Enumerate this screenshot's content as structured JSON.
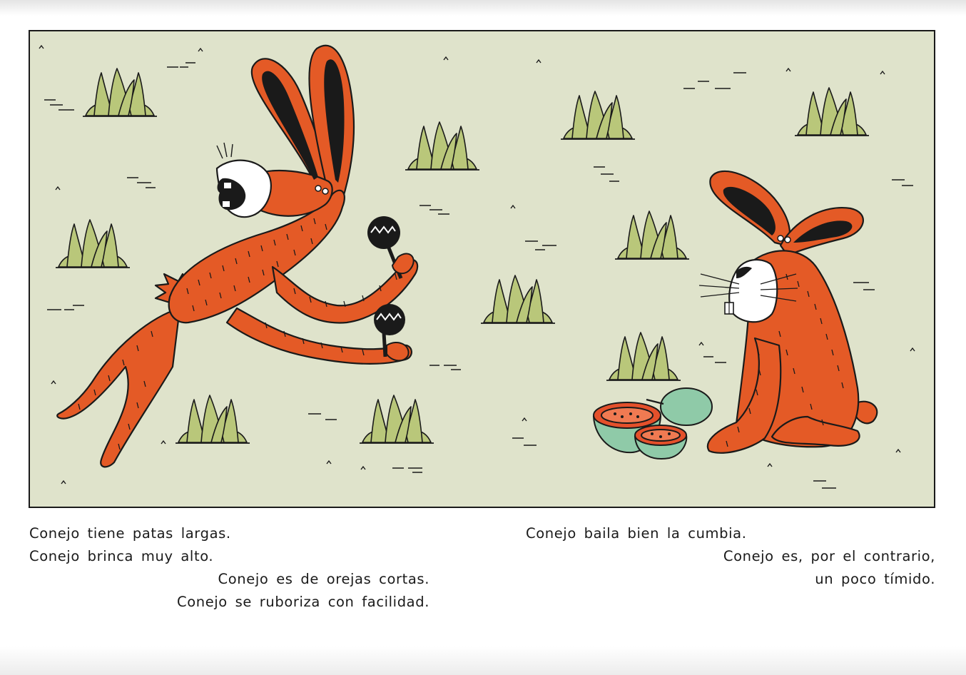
{
  "captions": {
    "left_top": [
      "Conejo tiene patas largas.",
      "Conejo brinca muy alto."
    ],
    "left_bottom": [
      "Conejo es de orejas cortas.",
      "Conejo se ruboriza con facilidad."
    ],
    "right_top": [
      "Conejo baila bien la cumbia."
    ],
    "right_bottom": [
      "Conejo es, por el contrario,",
      "un poco tímido."
    ]
  },
  "colors": {
    "background": "#dfe3cb",
    "rabbit": "#e45a26",
    "grass": "#b9c77a",
    "papaya_skin": "#8fcaa8",
    "papaya_flesh": "#e4502b",
    "outline": "#1a1a1a"
  },
  "icons": [
    "rabbit-jumping-icon",
    "rabbit-sitting-icon",
    "maraca-icon",
    "grass-tuft-icon",
    "papaya-icon"
  ]
}
